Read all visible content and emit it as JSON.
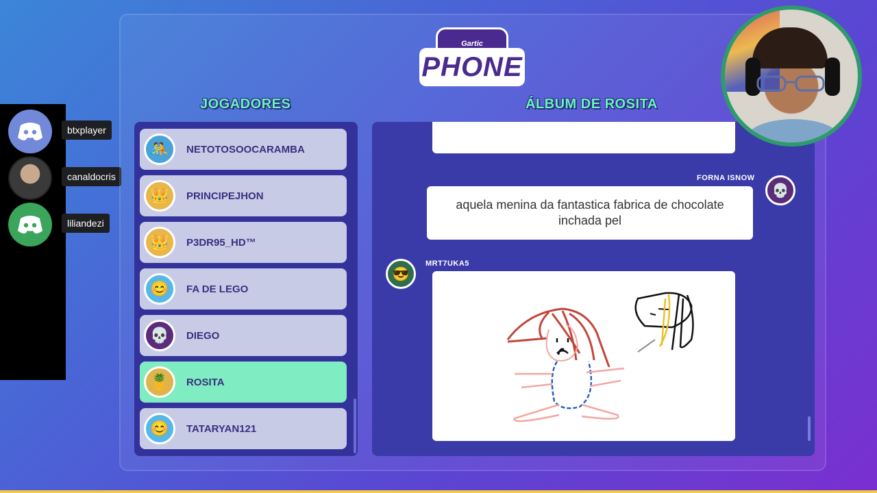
{
  "discord": {
    "users": [
      {
        "name": "btxplayer",
        "avatar": "discord-logo-icon"
      },
      {
        "name": "canaldocris",
        "avatar": "user-photo"
      },
      {
        "name": "liliandezi",
        "avatar": "discord-logo-icon"
      }
    ]
  },
  "logo": {
    "top": "Gartic",
    "main": "PHONE"
  },
  "players": {
    "title": "JOGADORES",
    "items": [
      {
        "name": "NETOTOSOOCARAMBA",
        "avatar": "luchador-icon"
      },
      {
        "name": "PRINCIPEJHON",
        "avatar": "king-face-icon"
      },
      {
        "name": "P3DR95_HD™",
        "avatar": "king-face-icon"
      },
      {
        "name": "FA DE LEGO",
        "avatar": "blue-girl-icon"
      },
      {
        "name": "DIEGO",
        "avatar": "skull-glasses-icon"
      },
      {
        "name": "ROSITA",
        "avatar": "pineapple-icon",
        "active": true
      },
      {
        "name": "TATARYAN121",
        "avatar": "blue-girl-icon"
      }
    ]
  },
  "album": {
    "title": "ÁLBUM DE ROSITA",
    "entries": [
      {
        "author": "FORNA ISNOW",
        "text": "aquela menina da fantastica fabrica de chocolate inchada pel"
      },
      {
        "author": "MRT7UKA5",
        "type": "drawing"
      }
    ]
  },
  "colors": {
    "accent": "#6ff0c4",
    "active_row": "#7fecc1",
    "panel": "#33329a"
  }
}
